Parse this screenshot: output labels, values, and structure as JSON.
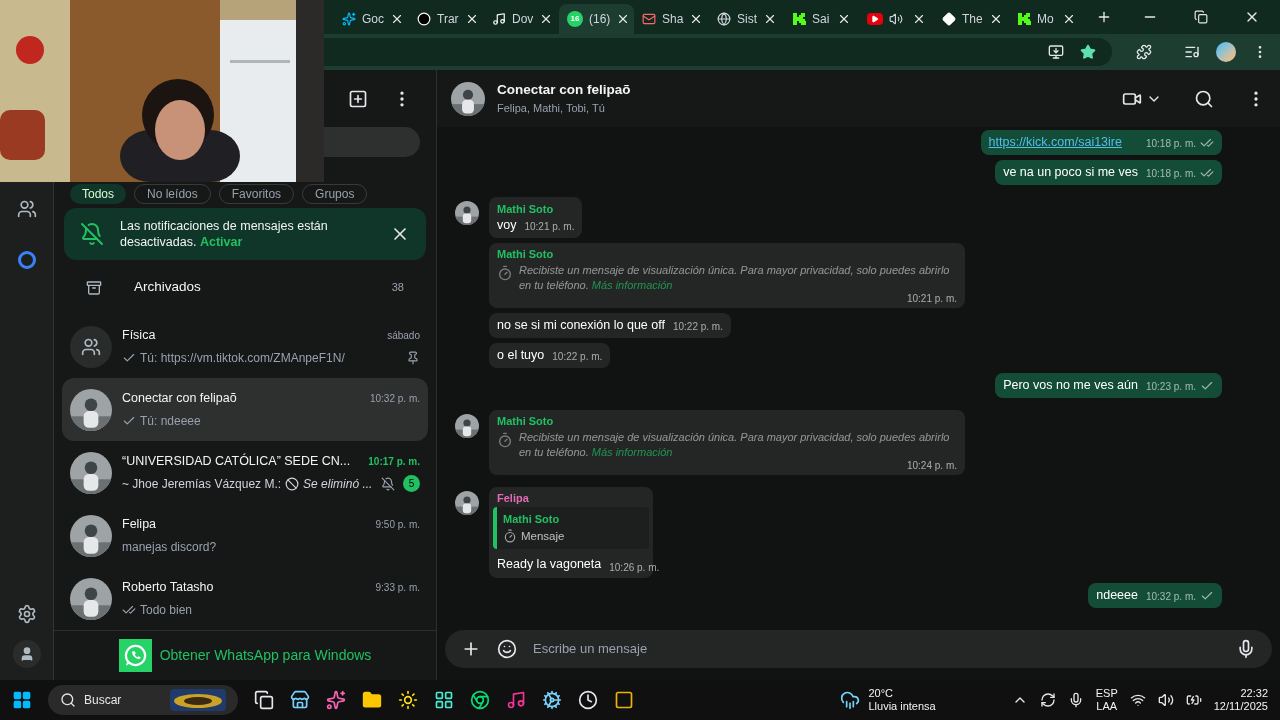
{
  "browser": {
    "tabs": [
      {
        "label": "Goc",
        "selected": false
      },
      {
        "label": "Trar",
        "selected": false
      },
      {
        "label": "Dov",
        "selected": false
      },
      {
        "label": "(16)",
        "badge": "16",
        "selected": true
      },
      {
        "label": "Sha",
        "selected": false
      },
      {
        "label": "Sist",
        "selected": false
      },
      {
        "label": "Sai",
        "selected": false
      },
      {
        "audio": true,
        "selected": false
      },
      {
        "label": "The",
        "selected": false
      },
      {
        "label": "Mo",
        "selected": false
      }
    ]
  },
  "filters": [
    {
      "label": "Todos",
      "selected": true
    },
    {
      "label": "No leídos",
      "selected": false
    },
    {
      "label": "Favoritos",
      "selected": false
    },
    {
      "label": "Grupos",
      "selected": false
    }
  ],
  "notice": {
    "text": "Las notificaciones de mensajes están desactivadas.",
    "action": "Activar"
  },
  "archived": {
    "label": "Archivados",
    "count": "38"
  },
  "chats": [
    {
      "kind": "group",
      "name": "Física",
      "time": "sábado",
      "sent": true,
      "delivered": false,
      "preview": "Tú: https://vm.tiktok.com/ZMAnpeF1N/",
      "pinned": true,
      "muted": false,
      "selected": false
    },
    {
      "kind": "contact",
      "name": "Conectar con felipaõ",
      "time": "10:32 p. m.",
      "sent": true,
      "delivered": false,
      "preview": "Tú: ndeeee",
      "pinned": false,
      "muted": false,
      "selected": true
    },
    {
      "kind": "contact",
      "name": "“UNIVERSIDAD CATÓLICA” SEDE CN...",
      "time": "10:17 p. m.",
      "sent": false,
      "author": "~ Jhoe Jeremías Vázquez M.:",
      "deleted": true,
      "preview": "Se eliminó ...",
      "pinned": false,
      "muted": true,
      "unread": "5",
      "selected": false
    },
    {
      "kind": "contact",
      "name": "Felipa",
      "time": "9:50 p. m.",
      "sent": false,
      "preview": "manejas discord?",
      "pinned": false,
      "muted": false,
      "selected": false
    },
    {
      "kind": "contact",
      "name": "Roberto Tatasho",
      "time": "9:33 p. m.",
      "sent": true,
      "delivered": true,
      "preview": "Todo bien",
      "pinned": false,
      "muted": false,
      "selected": false
    }
  ],
  "download": {
    "label": "Obtener WhatsApp para Windows"
  },
  "chat": {
    "title": "Conectar con felipaõ",
    "subtitle": "Felipa, Mathi, Tobi, Tú"
  },
  "messages": [
    {
      "kind": "out",
      "link": true,
      "text": "https://kick.com/sai13ire",
      "time": "10:18 p. m.",
      "delivered": true
    },
    {
      "kind": "out",
      "link": false,
      "text": "ve na un poco si me ves",
      "time": "10:18 p. m.",
      "delivered": true
    },
    {
      "kind": "in",
      "avatar": true,
      "sender": "Mathi Soto",
      "color": "#21c063",
      "text": "voy",
      "time": "10:21 p. m."
    },
    {
      "kind": "view_once",
      "avatar": false,
      "sender": "Mathi Soto",
      "color": "#21c063",
      "text": "Recibiste un mensaje de visualización única. Para mayor privacidad, solo puedes abrirlo en tu teléfono.",
      "more": "Más información",
      "time": "10:21 p. m."
    },
    {
      "kind": "in",
      "avatar": false,
      "text": "no se si mi conexión lo que off",
      "time": "10:22 p. m."
    },
    {
      "kind": "in",
      "avatar": false,
      "text": "o el tuyo",
      "time": "10:22 p. m."
    },
    {
      "kind": "out",
      "link": false,
      "text": "Pero vos no me ves aún",
      "time": "10:23 p. m.",
      "delivered": false
    },
    {
      "kind": "view_once",
      "avatar": true,
      "sender": "Mathi Soto",
      "color": "#21c063",
      "text": "Recibiste un mensaje de visualización única. Para mayor privacidad, solo puedes abrirlo en tu teléfono.",
      "more": "Más información",
      "time": "10:24 p. m."
    },
    {
      "kind": "reply",
      "avatar": true,
      "sender": "Felipa",
      "color": "#e26ab6",
      "quote": {
        "sender": "Mathi Soto",
        "color": "#21c063",
        "text": "Mensaje"
      },
      "text": "Ready la vagoneta",
      "time": "10:26 p. m."
    },
    {
      "kind": "out",
      "link": false,
      "text": "ndeeee",
      "time": "10:32 p. m.",
      "delivered": false
    }
  ],
  "composer": {
    "placeholder": "Escribe un mensaje"
  },
  "taskbar": {
    "search": "Buscar",
    "weather": {
      "temp": "20°C",
      "desc": "Lluvia intensa"
    },
    "lang": "ESP",
    "layout": "LAA",
    "time": "22:32",
    "date": "12/11/2025"
  }
}
